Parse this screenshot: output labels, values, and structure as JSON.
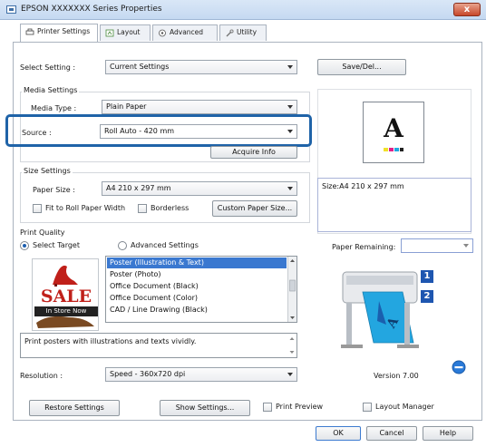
{
  "window": {
    "title": "EPSON XXXXXXX Series Properties",
    "close_label": "x"
  },
  "tabs": [
    {
      "label": "Printer Settings"
    },
    {
      "label": "Layout"
    },
    {
      "label": "Advanced"
    },
    {
      "label": "Utility"
    }
  ],
  "select_setting": {
    "label": "Select Setting :",
    "value": "Current Settings",
    "save_button": "Save/Del..."
  },
  "media": {
    "group_label": "Media Settings",
    "media_type_label": "Media Type :",
    "media_type_value": "Plain Paper",
    "source_label": "Source :",
    "source_value": "Roll Auto - 420 mm",
    "acquire_button": "Acquire Info"
  },
  "size": {
    "group_label": "Size Settings",
    "paper_size_label": "Paper Size :",
    "paper_size_value": "A4 210 x 297 mm",
    "fit_label": "Fit to Roll Paper Width",
    "borderless_label": "Borderless",
    "custom_button": "Custom Paper Size..."
  },
  "preview": {
    "letter": "A",
    "size_text": "Size:A4 210 x 297 mm"
  },
  "quality": {
    "group_label": "Print Quality",
    "select_target_label": "Select Target",
    "advanced_label": "Advanced Settings",
    "targets": [
      "Poster (Illustration & Text)",
      "Poster (Photo)",
      "Office Document (Black)",
      "Office Document (Color)",
      "CAD / Line Drawing (Black)"
    ],
    "description": "Print posters with illustrations and texts vividly.",
    "resolution_label": "Resolution :",
    "resolution_value": "Speed - 360x720 dpi"
  },
  "thumbnail": {
    "sale": "SALE",
    "instore": "In Store Now"
  },
  "paper_remaining": {
    "label": "Paper Remaining:",
    "value": ""
  },
  "printer_image": {
    "badge1": "1",
    "badge2": "2",
    "sheet_letter": "A"
  },
  "version": "Version 7.00",
  "bottom": {
    "restore_button": "Restore Settings",
    "show_button": "Show Settings...",
    "print_preview_label": "Print Preview",
    "layout_manager_label": "Layout Manager"
  },
  "dialog": {
    "ok": "OK",
    "cancel": "Cancel",
    "help": "Help"
  },
  "colors": {
    "highlight": "#1f63a8",
    "selection": "#3a78d0",
    "title_bg": "#c5d9f1"
  }
}
